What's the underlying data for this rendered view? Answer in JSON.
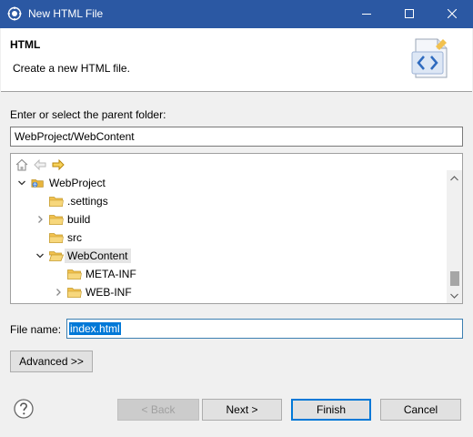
{
  "window": {
    "title": "New HTML File",
    "icons": {
      "app": "eclipse-icon",
      "minimize": "minimize-icon",
      "maximize": "maximize-icon",
      "close": "close-icon"
    }
  },
  "header": {
    "title": "HTML",
    "description": "Create a new HTML file.",
    "icon": "html-file-wizard-icon"
  },
  "folder": {
    "label": "Enter or select the parent folder:",
    "value": "WebProject/WebContent"
  },
  "tree": {
    "toolbar": [
      "home-icon",
      "back-arrow-icon",
      "forward-arrow-icon"
    ],
    "items": [
      {
        "label": "WebProject",
        "expanded": true,
        "icon": "project-icon"
      },
      {
        "label": ".settings",
        "icon": "folder-icon"
      },
      {
        "label": "build",
        "collapsed": true,
        "icon": "folder-icon"
      },
      {
        "label": "src",
        "icon": "folder-icon"
      },
      {
        "label": "WebContent",
        "expanded": true,
        "selected": true,
        "icon": "open-folder-icon"
      },
      {
        "label": "META-INF",
        "icon": "folder-icon"
      },
      {
        "label": "WEB-INF",
        "collapsed": true,
        "icon": "folder-icon"
      }
    ]
  },
  "filename": {
    "label": "File name:",
    "value": "index.html"
  },
  "buttons": {
    "advanced": "Advanced >>",
    "back": "< Back",
    "next": "Next >",
    "finish": "Finish",
    "cancel": "Cancel"
  },
  "colors": {
    "titlebar": "#2b58a3",
    "selection": "#0078d7",
    "folder": "#e8b53c"
  }
}
